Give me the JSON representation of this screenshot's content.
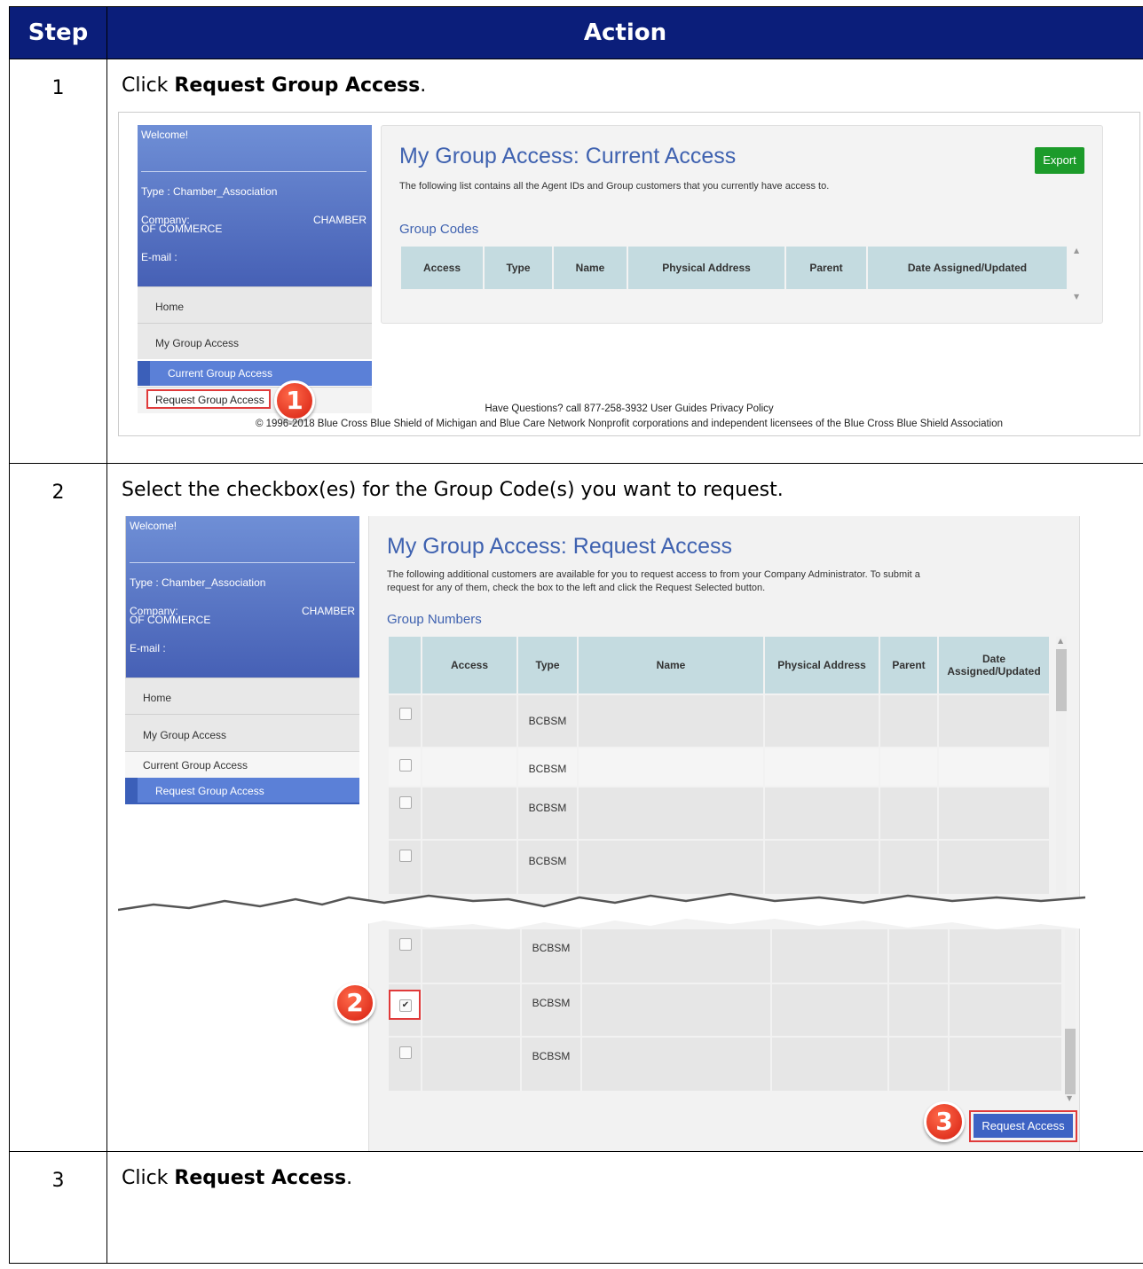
{
  "table": {
    "headers": {
      "step": "Step",
      "action": "Action"
    },
    "rows": [
      {
        "num": "1",
        "pre": "Click ",
        "bold": "Request Group Access",
        "post": "."
      },
      {
        "num": "2",
        "text": "Select the checkbox(es) for the Group Code(s) you want to request."
      },
      {
        "num": "3",
        "pre": "Click ",
        "bold": "Request Access",
        "post": "."
      }
    ]
  },
  "shot1": {
    "sidebar": {
      "welcome": "Welcome!",
      "type": "Type : Chamber_Association",
      "company_label": "Company:",
      "company_value": "CHAMBER",
      "company_value2": "OF COMMERCE",
      "email": "E-mail :",
      "menu": [
        "Home",
        "My Group Access",
        "Current Group Access",
        "Request Group Access"
      ]
    },
    "title": "My Group Access: Current Access",
    "description": "The following list contains all the Agent IDs and Group customers that you currently have access to.",
    "export_label": "Export",
    "section": "Group Codes",
    "columns": [
      "Access",
      "Type",
      "Name",
      "Physical Address",
      "Parent",
      "Date Assigned/Updated"
    ],
    "footer1": "Have Questions? call 877-258-3932 User Guides Privacy Policy",
    "footer2": "© 1996-2018 Blue Cross Blue Shield of Michigan and Blue Care Network Nonprofit corporations and independent licensees of the Blue Cross Blue Shield Association",
    "badge": "1"
  },
  "shot2": {
    "sidebar": {
      "welcome": "Welcome!",
      "type": "Type : Chamber_Association",
      "company_label": "Company:",
      "company_value": "CHAMBER",
      "company_value2": "OF COMMERCE",
      "email": "E-mail :",
      "menu": [
        "Home",
        "My Group Access",
        "Current Group Access",
        "Request Group Access"
      ]
    },
    "title": "My Group Access: Request Access",
    "description1": "The following additional customers are available for you to request access to from your Company Administrator. To submit a",
    "description2": "request for any of them, check the box to the left and click the Request Selected button.",
    "section": "Group Numbers",
    "columns": [
      "Access",
      "Type",
      "Name",
      "Physical Address",
      "Parent",
      "Date",
      "Assigned/Updated"
    ],
    "row_type": "BCBSM",
    "button": "Request Access",
    "badge2": "2",
    "badge3": "3"
  }
}
